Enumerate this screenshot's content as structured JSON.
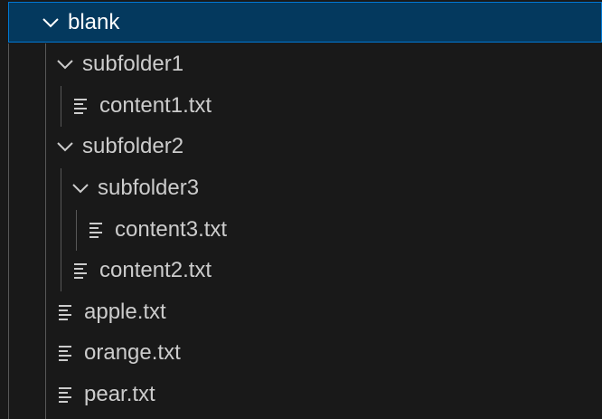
{
  "tree": {
    "root": {
      "label": "blank",
      "expanded": true,
      "selected": true
    },
    "items": [
      {
        "label": "subfolder1",
        "type": "folder",
        "expanded": true,
        "depth": 1
      },
      {
        "label": "content1.txt",
        "type": "file",
        "depth": 2
      },
      {
        "label": "subfolder2",
        "type": "folder",
        "expanded": true,
        "depth": 1
      },
      {
        "label": "subfolder3",
        "type": "folder",
        "expanded": true,
        "depth": 2
      },
      {
        "label": "content3.txt",
        "type": "file",
        "depth": 3
      },
      {
        "label": "content2.txt",
        "type": "file",
        "depth": 2
      },
      {
        "label": "apple.txt",
        "type": "file",
        "depth": 1
      },
      {
        "label": "orange.txt",
        "type": "file",
        "depth": 1
      },
      {
        "label": "pear.txt",
        "type": "file",
        "depth": 1
      }
    ]
  },
  "icons": {
    "folder_open": "chevron-down-icon",
    "file": "text-file-icon"
  },
  "colors": {
    "background": "#191919",
    "selection_background": "#04395e",
    "selection_border": "#0078d4",
    "text": "#cccccc",
    "selected_text": "#ffffff",
    "indent_guide": "#585858"
  }
}
